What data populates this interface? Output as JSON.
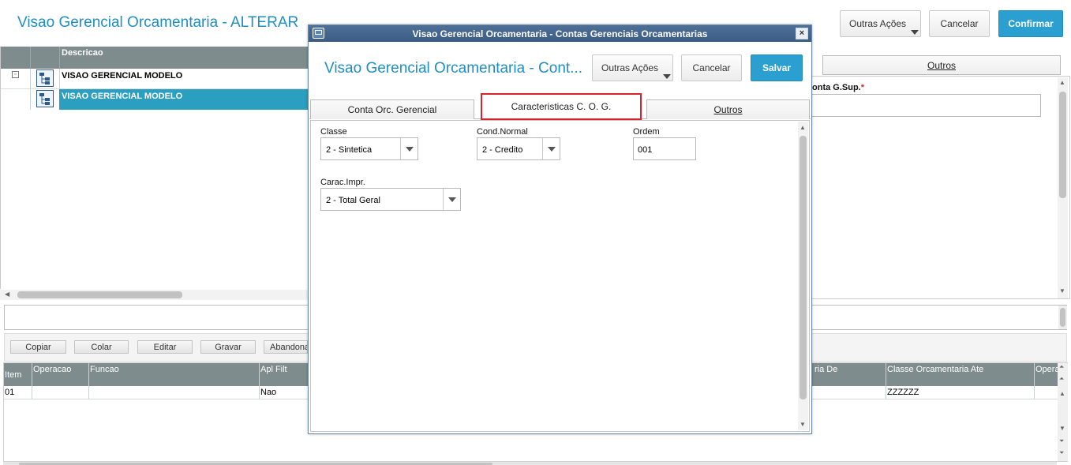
{
  "main": {
    "title": "Visao Gerencial Orcamentaria - ALTERAR",
    "actions": {
      "other": "Outras Ações",
      "cancel": "Cancelar",
      "confirm": "Confirmar"
    }
  },
  "tree": {
    "column_header": "Descricao",
    "rows": [
      {
        "label": "VISAO GERENCIAL MODELO",
        "selected": false
      },
      {
        "label": "VISAO GERENCIAL MODELO",
        "selected": true
      }
    ]
  },
  "right_panel": {
    "tab_outros": "Outros",
    "field_label": "onta G.Sup.",
    "required_mark": "*"
  },
  "toolbar": {
    "copiar": "Copiar",
    "colar": "Colar",
    "editar": "Editar",
    "gravar": "Gravar",
    "abandonar": "Abandona"
  },
  "bottom_grid": {
    "headers": {
      "item": "Item",
      "operacao": "Operacao",
      "funcao": "Funcao",
      "apl_filt": "Apl Filt",
      "classe_de": "ria De",
      "classe_ate": "Classe Orcamentaria Ate",
      "opera": "Opera"
    },
    "row": {
      "item": "01",
      "operacao": "",
      "funcao": "",
      "apl_filt": "Nao",
      "classe_ate": "ZZZZZZ"
    }
  },
  "modal": {
    "window_title": "Visao Gerencial Orcamentaria - Contas Gerenciais Orcamentarias",
    "title": "Visao Gerencial Orcamentaria - Cont...",
    "actions": {
      "other": "Outras Ações",
      "cancel": "Cancelar",
      "save": "Salvar"
    },
    "tabs": [
      "Conta Orc. Gerencial",
      "Caracteristicas C. O. G.",
      "Outros"
    ],
    "active_tab": "Caracteristicas C. O. G.",
    "fields": {
      "classe": {
        "label": "Classe",
        "value": "2 - Sintetica"
      },
      "cond_normal": {
        "label": "Cond.Normal",
        "value": "2 - Credito"
      },
      "ordem": {
        "label": "Ordem",
        "value": "001"
      },
      "carac_impr": {
        "label": "Carac.Impr.",
        "value": "2 - Total Geral"
      }
    }
  },
  "colors": {
    "accent": "#2a9fd0",
    "title": "#1f8fc0",
    "header_gray": "#7e8c8d",
    "selected_row": "#2a9fbf",
    "highlight": "#d9232a"
  }
}
